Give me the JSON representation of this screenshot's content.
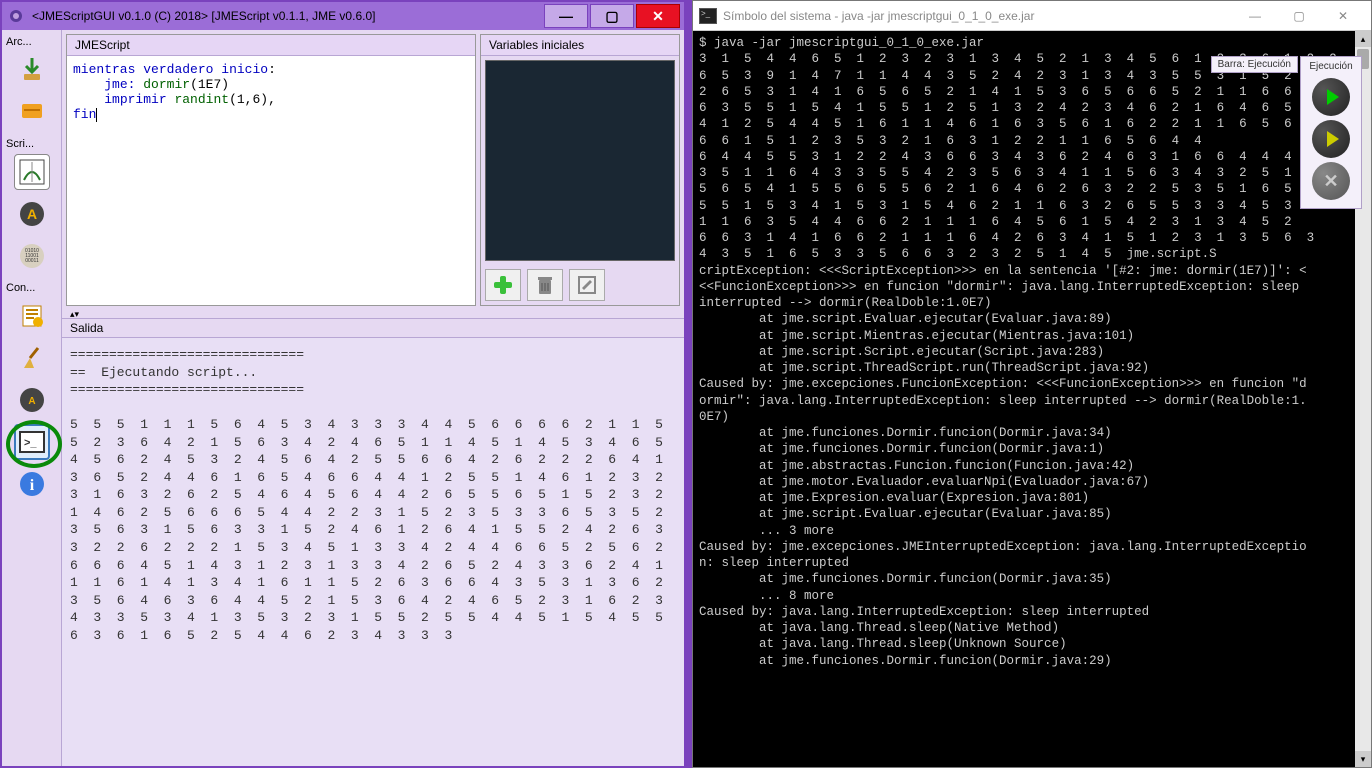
{
  "main_window": {
    "title": "<JMEScriptGUI v0.1.0 (C) 2018>     [JMEScript v0.1.1, JME v0.6.0]",
    "sidebar": {
      "sections": [
        "Arc...",
        "Scri...",
        "Con..."
      ]
    },
    "script_panel_title": "JMEScript",
    "code": {
      "line1_kw": "mientras",
      "line1_kw2": "verdadero",
      "line1_kw3": "inicio",
      "line2_kw": "jme:",
      "line2_fn": "dormir",
      "line2_args": "(1E7)",
      "line3_kw": "imprimir",
      "line3_fn": "randint",
      "line3_args": "(1,6)",
      "line4_kw": "fin"
    },
    "vars_panel_title": "Variables iniciales",
    "output_title": "Salida",
    "output_text": "==============================\n==  Ejecutando script...\n==============================\n\n5  5  5  1  1  1  5  6  4  5  3  4  3  3  3  4  4  5  6  6  6  6  2  1  1  5  5  2  3  6  4  2  1  5  6  3  4  2  4  6  5  1  1  4  5  1  4  5  3  4  6  5  4  5  6  2  4  5  3  2  4  5  6  4  2  5  5  6  6  4  2  6  2  2  2  6  4  1  3  6  5  2  4  4  6  1  6  5  4  6  6  4  4  1  2  5  5  1  4  6  1  2  3  2  3  1  6  3  2  6  2  5  4  6  4  5  6  4  4  2  6  5  5  6  5  1  5  2  3  2  1  4  6  2  5  6  6  6  5  4  4  2  2  3  1  5  2  3  5  3  3  6  5  3  5  2  3  5  6  3  1  5  6  3  3  1  5  2  4  6  1  2  6  4  1  5  5  2  4  2  6  3  3  2  2  6  2  2  2  1  5  3  4  5  1  3  3  4  2  4  4  6  6  5  2  5  6  2  6  6  6  4  5  1  4  3  1  2  3  1  3  3  4  2  6  5  2  4  3  3  6  2  4  1  1  1  6  1  4  1  3  4  1  6  1  1  5  2  6  3  6  6  4  3  5  3  1  3  6  2  3  5  6  4  6  3  6  4  4  5  2  1  5  3  6  4  2  4  6  5  2  3  1  6  2  3  4  3  3  5  3  4  1  3  5  3  2  3  1  5  5  2  5  5  4  4  5  1  5  4  5  5  6  3  6  1  6  5  2  5  4  4  6  2  3  4  3  3  3"
  },
  "console": {
    "title": "Símbolo del sistema - java -jar jmescriptgui_0_1_0_exe.jar",
    "body": "$ java -jar jmescriptgui_0_1_0_exe.jar\n3  1  5  4  4  6  5  1  2  3  2  3  1  3  4  5  2  1  3  4  5  6  1  2  3  6  1  2  2\n6  5  3  9  1  4  7  1  1  4  4  3  5  2  4  2  3  1  3  4  3  5  5  3  1  5  2  6  5  8\n2  6  5  3  1  4  1  6  5  6  5  2  1  4  1  5  3  6  5  6  6  5  2  1  1  6  6  4  4\n6  3  5  5  1  5  4  1  5  5  1  2  5  1  3  2  4  2  3  4  6  2  1  6  4  6  5  6  4\n4  1  2  5  4  4  5  1  6  1  1  4  6  1  6  3  5  6  1  6  2  2  1  1  6  5  6  4  4\n6  6  1  5  1  2  3  5  3  2  1  6  3  1  2  2  1  1  6  5  6  4  4\n6  4  4  5  5  3  1  2  2  4  3  6  6  3  4  3  6  2  4  6  3  1  6  6  4  4  4  3  5  2\n3  5  1  1  6  4  3  3  5  5  4  2  3  5  6  3  4  1  1  5  6  3  4  3  2  5  1\n5  6  5  4  1  5  5  6  5  5  6  2  1  6  4  6  2  6  3  2  2  5  3  5  1  6  5  4\n5  5  1  5  3  4  1  5  3  1  5  4  6  2  1  1  6  3  2  6  5  5  3  3  4  5  3  6\n1  1  6  3  5  4  4  6  6  2  1  1  1  6  4  5  6  1  5  4  2  3  1  3  4  5  2\n6  6  3  1  4  1  6  6  2  1  1  1  6  4  2  6  3  4  1  5  1  2  3  1  3  5  6  3\n4  3  5  1  6  5  3  3  5  6  6  3  2  3  2  5  1  4  5  jme.script.S\ncriptException: <<<ScriptException>>> en la sentencia '[#2: jme: dormir(1E7)]': <\n<<FuncionException>>> en funcion \"dormir\": java.lang.InterruptedException: sleep\ninterrupted --> dormir(RealDoble:1.0E7)\n        at jme.script.Evaluar.ejecutar(Evaluar.java:89)\n        at jme.script.Mientras.ejecutar(Mientras.java:101)\n        at jme.script.Script.ejecutar(Script.java:283)\n        at jme.script.ThreadScript.run(ThreadScript.java:92)\nCaused by: jme.excepciones.FuncionException: <<<FuncionException>>> en funcion \"d\normir\": java.lang.InterruptedException: sleep interrupted --> dormir(RealDoble:1.\n0E7)\n        at jme.funciones.Dormir.funcion(Dormir.java:34)\n        at jme.funciones.Dormir.funcion(Dormir.java:1)\n        at jme.abstractas.Funcion.funcion(Funcion.java:42)\n        at jme.motor.Evaluador.evaluarNpi(Evaluador.java:67)\n        at jme.Expresion.evaluar(Expresion.java:801)\n        at jme.script.Evaluar.ejecutar(Evaluar.java:85)\n        ... 3 more\nCaused by: jme.excepciones.JMEInterruptedException: java.lang.InterruptedExceptio\nn: sleep interrupted\n        at jme.funciones.Dormir.funcion(Dormir.java:35)\n        ... 8 more\nCaused by: java.lang.InterruptedException: sleep interrupted\n        at java.lang.Thread.sleep(Native Method)\n        at java.lang.Thread.sleep(Unknown Source)\n        at jme.funciones.Dormir.funcion(Dormir.java:29)"
  },
  "exec_toolbar": {
    "barra_label": "Barra: Ejecución",
    "title": "Ejecución"
  }
}
